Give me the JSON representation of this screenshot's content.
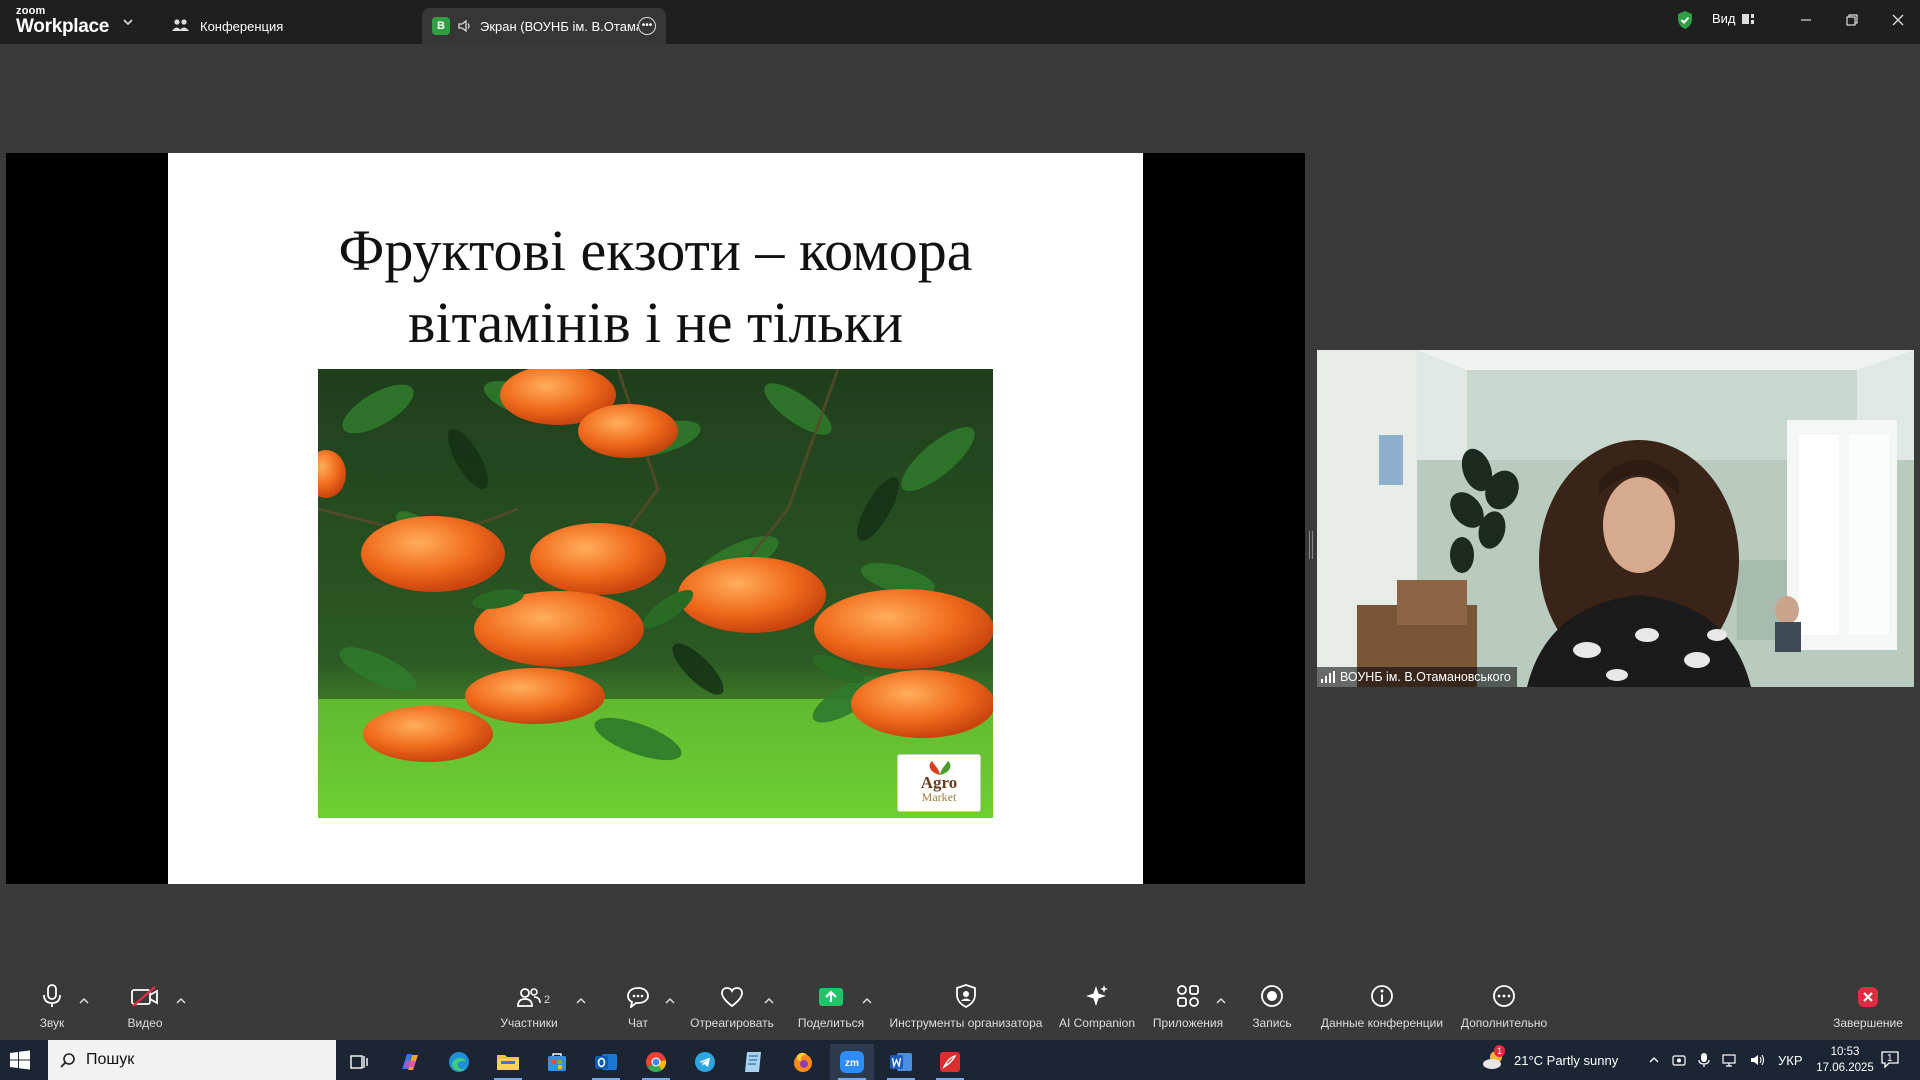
{
  "app": {
    "brand_top": "zoom",
    "brand_main": "Workplace"
  },
  "tabs": [
    {
      "label": "Конференция",
      "icon": "people-icon"
    },
    {
      "badge": "В",
      "label": "Экран (ВОУНБ ім. В.Отаман",
      "icon": "speaker-icon"
    }
  ],
  "header": {
    "view_label": "Вид"
  },
  "slide": {
    "title_line1": "Фруктові екзоти – комора",
    "title_line2": "вітамінів і не тільки",
    "logo_line1": "Agro",
    "logo_line2": "Market"
  },
  "video": {
    "participant_name": "ВОУНБ ім. В.Отамановського"
  },
  "toolbar": {
    "audio": "Звук",
    "video": "Видео",
    "participants": "Участники",
    "participants_count": "2",
    "chat": "Чат",
    "react": "Отреагировать",
    "share": "Поделиться",
    "host_tools": "Инструменты организатора",
    "ai": "AI Companion",
    "apps": "Приложения",
    "record": "Запись",
    "info": "Данные конференции",
    "more": "Дополнительно",
    "end": "Завершение"
  },
  "taskbar": {
    "search_placeholder": "Пошук",
    "weather": "21°C  Partly sunny",
    "weather_alert": "1",
    "lang": "УКР",
    "time": "10:53",
    "date": "17.06.2025",
    "notifications": "1"
  },
  "colors": {
    "accent_green": "#2ea043",
    "end_red": "#e02b41",
    "share_green": "#22c36a"
  }
}
